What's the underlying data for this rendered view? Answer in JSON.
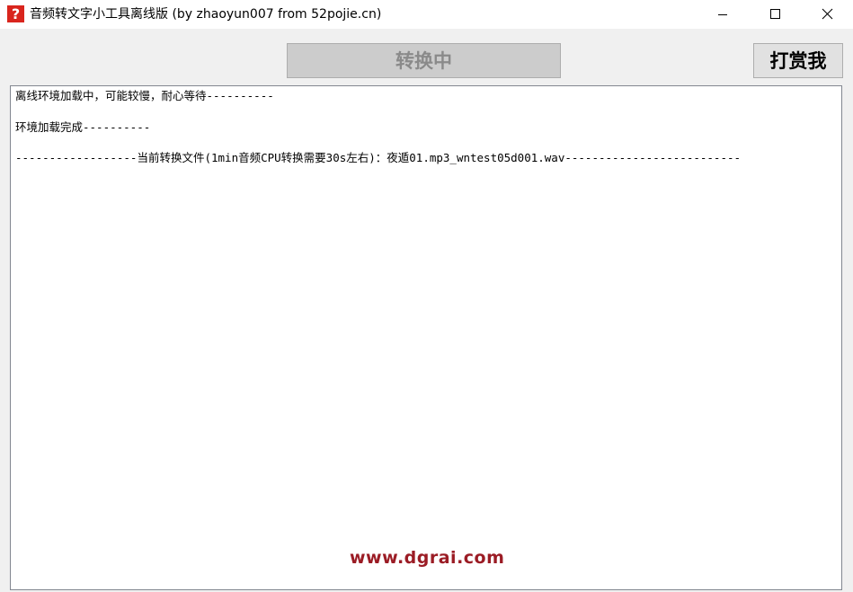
{
  "window": {
    "title": "音频转文字小工具离线版 (by zhaoyun007 from 52pojie.cn)",
    "app_icon_glyph": "?",
    "app_icon_name": "question-icon",
    "caption_buttons": [
      "minimize-icon",
      "maximize-icon",
      "close-icon"
    ]
  },
  "toolbar": {
    "convert_label": "转换中",
    "convert_state": "disabled",
    "donate_label": "打赏我"
  },
  "log": {
    "lines": [
      "离线环境加载中，可能较慢，耐心等待----------",
      "环境加载完成----------",
      "------------------当前转换文件(1min音频CPU转换需要30s左右)：夜遁01.mp3_wntest05d001.wav--------------------------"
    ]
  },
  "watermark": {
    "text": "www.dgrai.com"
  },
  "colors": {
    "app_icon": "#d9251d",
    "watermark": "#9b1c25",
    "disabled_button_bg": "#cccccc",
    "disabled_button_text": "#8a8a8a"
  }
}
